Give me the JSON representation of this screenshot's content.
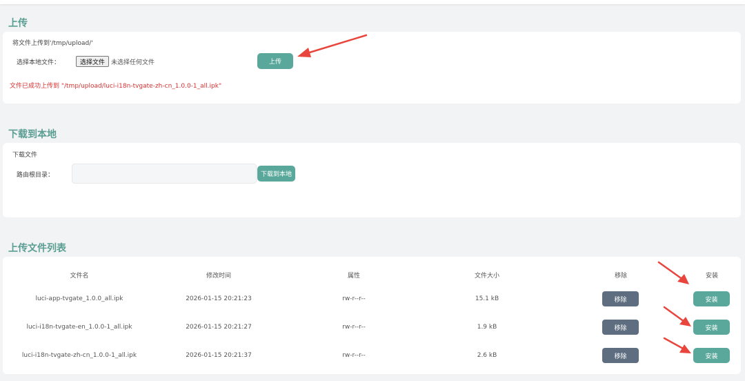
{
  "upload": {
    "section_title": "上传",
    "hint": "将文件上传到'/tmp/upload/'",
    "field_label": "选择本地文件：",
    "choose_button": "选择文件",
    "no_file_text": "未选择任何文件",
    "upload_button": "上传",
    "success_message": "文件已成功上传到 \"/tmp/upload/luci-i18n-tvgate-zh-cn_1.0.0-1_all.ipk\""
  },
  "download": {
    "section_title": "下载到本地",
    "hint": "下载文件",
    "field_label": "路由根目录：",
    "path_value": "",
    "download_button": "下载到本地"
  },
  "file_list": {
    "section_title": "上传文件列表",
    "headers": {
      "name": "文件名",
      "mtime": "修改时间",
      "attr": "属性",
      "size": "文件大小",
      "remove": "移除",
      "install": "安装"
    },
    "rows": [
      {
        "name": "luci-app-tvgate_1.0.0_all.ipk",
        "mtime": "2026-01-15 20:21:23",
        "attr": "rw-r--r--",
        "size": "15.1 kB",
        "remove": "移除",
        "install": "安装"
      },
      {
        "name": "luci-i18n-tvgate-en_1.0.0-1_all.ipk",
        "mtime": "2026-01-15 20:21:27",
        "attr": "rw-r--r--",
        "size": "1.9 kB",
        "remove": "移除",
        "install": "安装"
      },
      {
        "name": "luci-i18n-tvgate-zh-cn_1.0.0-1_all.ipk",
        "mtime": "2026-01-15 20:21:37",
        "attr": "rw-r--r--",
        "size": "2.6 kB",
        "remove": "移除",
        "install": "安装"
      }
    ]
  },
  "colors": {
    "accent": "#5aa89b",
    "remove_button": "#5e6e80",
    "error_text": "#d63030",
    "annotation_arrow": "#e8453c"
  },
  "icons": [
    "annotation-arrow-icon"
  ]
}
